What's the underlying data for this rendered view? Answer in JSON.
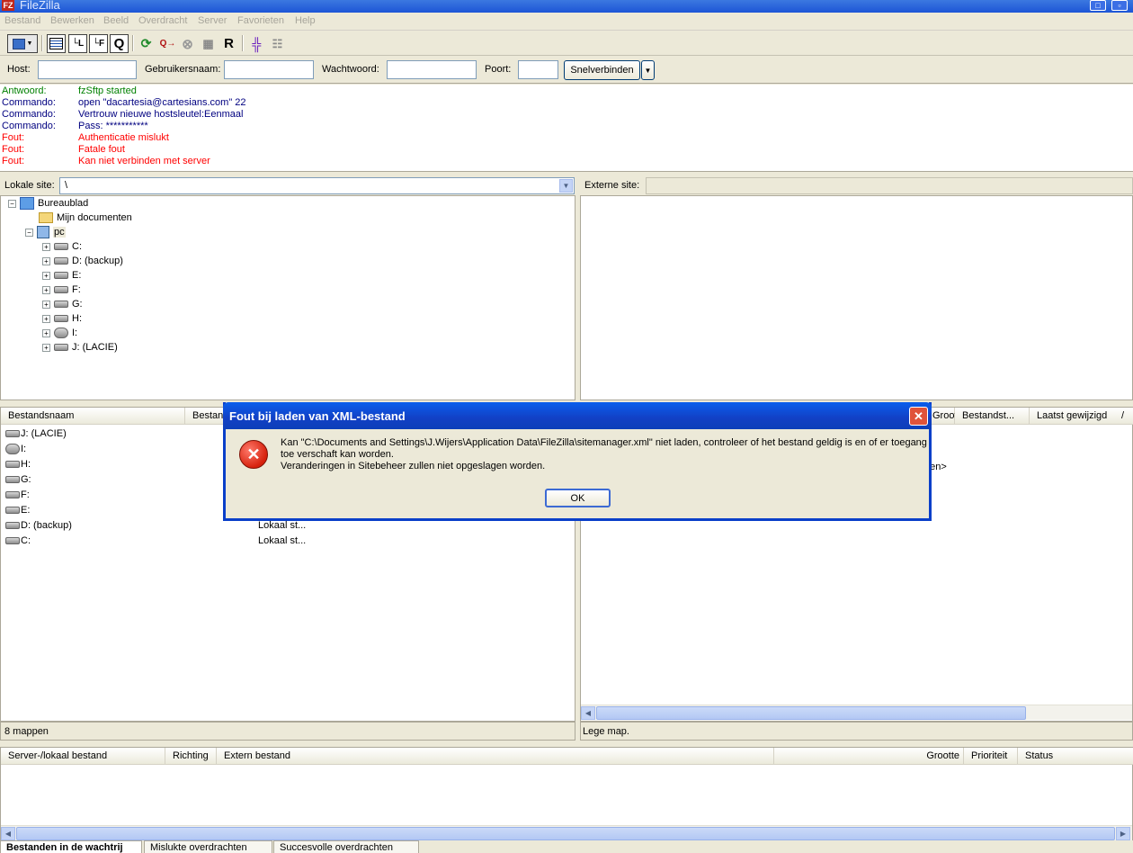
{
  "window": {
    "title": "FileZilla",
    "app_icon": "FZ"
  },
  "menu": [
    "Bestand",
    "Bewerken",
    "Beeld",
    "Overdracht",
    "Server",
    "Favorieten",
    "Help"
  ],
  "toolbar_icons": [
    "site-manager-icon",
    "dropdown-arrow-icon",
    "toggle-log-icon",
    "toggle-local-tree-icon",
    "toggle-remote-tree-icon",
    "toggle-queue-icon",
    "refresh-icon",
    "process-queue-icon",
    "cancel-icon",
    "disconnect-icon",
    "reconnect-icon",
    "directory-compare-icon",
    "filter-icon"
  ],
  "quickconnect": {
    "host_label": "Host:",
    "user_label": "Gebruikersnaam:",
    "pass_label": "Wachtwoord:",
    "port_label": "Poort:",
    "host_value": "",
    "user_value": "",
    "pass_value": "",
    "port_value": "",
    "connect_button": "Snelverbinden",
    "dropdown_glyph": "▼"
  },
  "log": [
    {
      "kind": "Antwoord:",
      "text": "fzSftp started",
      "color": "#008000"
    },
    {
      "kind": "Commando:",
      "text": "open \"dacartesia@cartesians.com\" 22",
      "color": "#000080"
    },
    {
      "kind": "Commando:",
      "text": "Vertrouw nieuwe hostsleutel:Eenmaal",
      "color": "#000080"
    },
    {
      "kind": "Commando:",
      "text": "Pass: ***********",
      "color": "#000080"
    },
    {
      "kind": "Fout:",
      "text": "Authenticatie mislukt",
      "color": "#ff0000"
    },
    {
      "kind": "Fout:",
      "text": "Fatale fout",
      "color": "#ff0000"
    },
    {
      "kind": "Fout:",
      "text": "Kan niet verbinden met server",
      "color": "#ff0000"
    }
  ],
  "local": {
    "site_label": "Lokale site:",
    "path": "\\",
    "tree": {
      "desktop": "Bureaublad",
      "documents": "Mijn documenten",
      "pc": "pc",
      "drives": [
        "C:",
        "D: (backup)",
        "E:",
        "F:",
        "G:",
        "H:",
        "I:",
        "J: (LACIE)"
      ]
    },
    "columns": {
      "name": "Bestandsnaam",
      "type": "Bestandstype"
    },
    "files": [
      {
        "name": "J: (LACIE)",
        "type": ""
      },
      {
        "name": "I:",
        "type": ""
      },
      {
        "name": "H:",
        "type": ""
      },
      {
        "name": "G:",
        "type": ""
      },
      {
        "name": "F:",
        "type": ""
      },
      {
        "name": "E:",
        "type": ""
      },
      {
        "name": "D: (backup)",
        "type": "Lokaal st..."
      },
      {
        "name": "C:",
        "type": "Lokaal st..."
      }
    ],
    "status": "8 mappen"
  },
  "remote": {
    "site_label": "Externe site:",
    "columns": {
      "size": "Grootte",
      "type": "Bestandst...",
      "modified": "Laatst gewijzigd",
      "sort": "/"
    },
    "empty_text_fragment": "den>",
    "status": "Lege map."
  },
  "queue": {
    "columns": {
      "file": "Server-/lokaal bestand",
      "direction": "Richting",
      "remote": "Extern bestand",
      "size": "Grootte",
      "priority": "Prioriteit",
      "status": "Status"
    },
    "tabs": [
      "Bestanden in de wachtrij",
      "Mislukte overdrachten",
      "Succesvolle overdrachten"
    ]
  },
  "dialog": {
    "title": "Fout bij laden van XML-bestand",
    "line1": "Kan \"C:\\Documents and Settings\\J.Wijers\\Application Data\\FileZilla\\sitemanager.xml\" niet laden, controleer of het bestand geldig is en of er toegang",
    "line2": "toe verschaft kan worden.",
    "line3": "Veranderingen in Sitebeheer zullen niet opgeslagen worden.",
    "ok": "OK",
    "close": "✕",
    "icon": "✕"
  }
}
